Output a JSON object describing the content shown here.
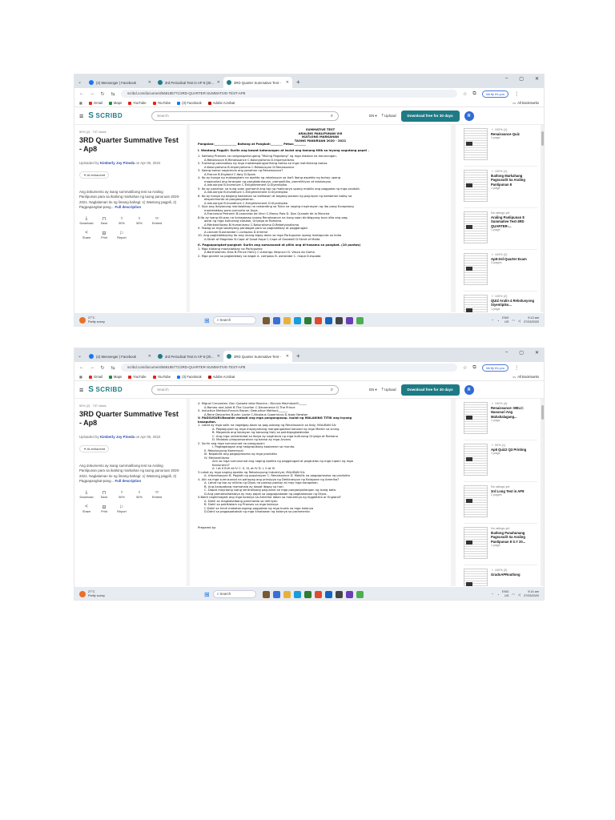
{
  "browser": {
    "tabs": [
      {
        "label": "(4) Messenger | Facebook",
        "icon": "facebook"
      },
      {
        "label": "3rd Periodical Test in AP 8 (2019-",
        "icon": "scribd"
      },
      {
        "label": "3RD Quarter Summative Test -",
        "icon": "scribd"
      }
    ],
    "new_tab": "+",
    "window_controls": [
      "–",
      "▢",
      "✕"
    ],
    "url": "scribd.com/document/568185771/3RD-QUARTER-SUMMATIVE-TEST-AP8",
    "verify_label": "Verify it's you",
    "bookmarks": [
      {
        "label": "Gmail",
        "color": "#d93025"
      },
      {
        "label": "Maps",
        "color": "#1e8e3e"
      },
      {
        "label": "YouTube",
        "color": "#e62117"
      },
      {
        "label": "YouTube",
        "color": "#e62117"
      },
      {
        "label": "(3) Facebook",
        "color": "#1877f2"
      },
      {
        "label": "Adobe Acrobat",
        "color": "#b30b00"
      }
    ],
    "all_bookmarks": "All Bookmarks"
  },
  "scribd": {
    "logo": "SCRIBD",
    "search_placeholder": "Search",
    "lang": "EN ▾",
    "upload": "Upload",
    "download_btn": "Download free for 30 days",
    "avatar": "R",
    "accent": "#1e7b85"
  },
  "doc_info": {
    "meta": "50% (2) · 737 views",
    "title": "3RD Quarter Summative Test - Ap8",
    "uploaded_prefix": "Uploaded by",
    "uploader": "Kimberly Joy Pineda",
    "uploaded_date": "on Apr 05, 2022",
    "ai_badge": "AI-enhanced",
    "description": "Ang dokumento ay isang summatibong test sa Araling Panlipunan para sa ikatlong markahan ng taong panuruan 2020-2021. Naglalaman ito ng limang bahagi: 1) Wastong pagpili, 2) Pagpapangkat-pang...",
    "full_desc": "Full description",
    "actions": [
      {
        "label": "Download",
        "icon": "⤓"
      },
      {
        "label": "Save",
        "icon": "⊓"
      },
      {
        "label": "50%",
        "icon": "♁"
      },
      {
        "label": "50%",
        "icon": "♁"
      },
      {
        "label": "Embed",
        "icon": "‹›"
      }
    ],
    "actions2": [
      {
        "label": "Share",
        "icon": "<"
      },
      {
        "label": "Print",
        "icon": "⊟"
      },
      {
        "label": "Report",
        "icon": "⚐"
      }
    ]
  },
  "page1": {
    "lines": [
      {
        "t": "SUMMATIVE TEST",
        "s": "c"
      },
      {
        "t": "ARALING PANLIPUNAN VIII",
        "s": "c"
      },
      {
        "t": "IKATLONG MARKAHAN",
        "s": "c"
      },
      {
        "t": "TAONG PANURUAN 2020 - 2021",
        "s": "c"
      },
      {
        "t": "Pangalan:_______________    Baitang at Pangkat:________    Petsa:________",
        "s": "b"
      },
      {
        "t": "",
        "s": "gap"
      },
      {
        "t": "I. Wastong Pagpili: Suriin ang bawat katanungan at isulat ang tamang titik sa inyong sagutang papel .",
        "s": "b"
      },
      {
        "t": "",
        "s": "gap"
      },
      {
        "t": "1. Salitang Pranses na nangangahulugang \"Muling Pagsilang\" ng mga klasikal na karunungan.",
        "s": ""
      },
      {
        "t": "A.Rebolusyon  B.Renaissance  C.Kolonyalismo  D.Imperyalismo",
        "s": "in1"
      },
      {
        "t": "2. Tuwirang pananakop ng mga makakapangyarihang bansa sa mga mahihinang bansa",
        "s": ""
      },
      {
        "t": "A.Kolonyalismo  B.Imperyalismo  C.Rebolusyon  D.Renaissance",
        "s": "in1"
      },
      {
        "t": "3. Saang bansa nagsimula ang panahon ng Renaissance?",
        "s": ""
      },
      {
        "t": "A.France  B.England  C.Italy  D.Spain",
        "s": "in1"
      },
      {
        "t": "4. Ito ay bunga ng makaagham na epekto ng rebelusyon sa iba't ibang aspekto ng buhay upang",
        "s": ""
      },
      {
        "t": "mapaunlad ang larangan ng pangkabuhayan, pampolitika, panrelihiyon at edukasyon.",
        "s": "in1"
      },
      {
        "t": "A.Industriyal  B.Inventure  C.Enlightenment  D.Siyentipiko",
        "s": "in1"
      },
      {
        "t": "5. Ito ay panahon na kung saan gumamit ang tao ng makinarya upang mabilis ang paggawa ng mga produkt.",
        "s": ""
      },
      {
        "t": "A.Industriyal  B.Invediture  C.Enlightenment  D.Siyentipiko",
        "s": "in1"
      },
      {
        "t": "6. Ito ay bunga ng bagong kaalaman sa kalikasan at bagong paraan ng pag-iipon ng kaalaman batay sa",
        "s": ""
      },
      {
        "t": "eksperimento at pangangatwiran.",
        "s": "in1"
      },
      {
        "t": "A.Industriyal  B.Invediture  C.Enlightenment  D.Siyentipiko",
        "s": "in1"
      },
      {
        "t": "7. Siya ang Italyanong manlalakbay na nakarating sa Tsina na naging inspirasyon ng iba pang Europeong",
        "s": ""
      },
      {
        "t": "manlalakbay para pumunta sa Asya.",
        "s": "in1"
      },
      {
        "t": "A.Francesco Petrarch  B.Leonardo da Vinci  C.Marco Polo  D. Don Quixote de la Mancha",
        "s": "in1"
      },
      {
        "t": "8.Ito ay isang kilusan na lumaganap noong Renaissance na kung saan binibigyang tuon dito ang pag-",
        "s": ""
      },
      {
        "t": "aaral ng mga kulturang klasikal, Griyego at Romano.",
        "s": "in1"
      },
      {
        "t": "A.Merkantilismo B.Humanismo C.Naturalismo D.Rebelyonalismo",
        "s": "in1"
      },
      {
        "t": "9. Tawag sa mga sasakyang pandagat para sa paglalakbay at paggalugad",
        "s": ""
      },
      {
        "t": "A.caravel  B.astrolabe  C.compass  D.trireme",
        "s": "in1"
      },
      {
        "t": "10. Ang paglalakbaying ito ang unang bigay daan sa mga Portuguese upang makapunta sa India",
        "s": ""
      },
      {
        "t": "A.Strait of Magellan  B.Cape of Good Hope  C.Cape of Goodwill  D.Strait of Malta",
        "s": "in1"
      },
      {
        "t": "",
        "s": "gap"
      },
      {
        "t": "II. Pagpapangkat-pangkat: Suriin ang sumusunod at piliin ang di-kasama sa pangkat. (10 puntos)",
        "s": "b"
      },
      {
        "t": "1. Mga kilalang manlalakbay na Portuguese",
        "s": ""
      },
      {
        "t": "A.Bartholomeu Dias  B.Prince Henry  C.Amerigo Vespucci D. Vasco da Gama",
        "s": "in1"
      },
      {
        "t": "2. Mga gnamit sa paglalakbay sa dagat A. compass B. astrolabe C. mapa  D.espada",
        "s": ""
      }
    ]
  },
  "page2": {
    "lines": [
      {
        "t": "4. Miguel Cervantes: Don Quixote dela Mancha ; Niccolo Machiavelli:_____",
        "s": ""
      },
      {
        "t": "A.Romeo and Juliet  B.The Courtier C.Decameron  D.The Prince",
        "s": "in1"
      },
      {
        "t": "5. Inductive Method:Francis Bacon; Deductive Method:______",
        "s": ""
      },
      {
        "t": "A.Rene Descartes  B.John Locke  C.Nicolaus Copernicus   D.Isaac Newton",
        "s": "in1"
      },
      {
        "t": "V. PAGSUSURI:Basahin mabuti ang mga pangungusap. Isulat ng MALAKING TITIK ang inyong",
        "s": "b"
      },
      {
        "t": "kasagutan.",
        "s": "b"
      },
      {
        "t": "1. Lahat ay mga salik na nagbigay-daan sa pag-usbong ng Renaissance sa Italy, MALIBAN SA:",
        "s": ""
      },
      {
        "t": "A.  Pagtaguyod ng mga mayayamang mangangalakal katulad ng mga Medici sa sining",
        "s": "in2"
      },
      {
        "t": "B.  Maganda ang lokasyon ng bansang Italy sa pakikipagkalakalan",
        "s": "in2"
      },
      {
        "t": "C.  Ang mga unibersidad sa Italya ay nagtuturo ng mga kulturang Griyego at Romano",
        "s": "in2"
      },
      {
        "t": "D.  Malakas pinoponsorohan ng bansa ay mga Arvans",
        "s": "in2"
      },
      {
        "t": "2. Suriin ang mga sumusunod na pangyayari:",
        "s": ""
      },
      {
        "t": "I. Pagtagatagan ang heograpikong kaalaman sa mundo.",
        "s": "in2"
      },
      {
        "t": "II. Rebolusyong Komersyal",
        "s": "in1"
      },
      {
        "t": "III. Napabilis ang pagpoproseso ng mga produkto",
        "s": "in1"
      },
      {
        "t": "IV. Merkantilismo",
        "s": "in1"
      },
      {
        "t": "Alin sa mga sumusunod ang naging epekto ng paggalugad at pagtuklas ng mga lupain ng mga",
        "s": "in2"
      },
      {
        "t": "Kanluranin?",
        "s": "in2"
      },
      {
        "t": "A. I at II  B.III at IV  C. II, III, at IV  D. I, II at IV",
        "s": "in2"
      },
      {
        "t": "3.Lahat ay mga naging epekto ng Rebolusyong Industriyal, MALIBAN SA:",
        "s": ""
      },
      {
        "t": "A. Urbanisasyon  B. Paglaki ng populasyon  C. Renaissance  D. Mabilis na pagpoproseso ng produkto",
        "s": "in1"
      },
      {
        "t": "4. Alin sa mga sumusunod na pahayag ang prinsipyo ng Deklarasyon ng Kalayaan ng Amerika?",
        "s": ""
      },
      {
        "t": "A. Lahat ng tao ay nilikha ng Diyos na pantay-pantay at may mga karapatan.",
        "s": "in1"
      },
      {
        "t": "B. Ang karapatang mamahala ay dapat ibigay sa hari.",
        "s": "in1"
      },
      {
        "t": "C. Dapat mayroong isang sentralisong pag-aaral sa mga pangangailangan ng isang bata.",
        "s": "in1"
      },
      {
        "t": "D.Ang pamamahalataya ay may papel sa pagpapalawak ng pagkakaroon ng Diyos.",
        "s": "in1"
      },
      {
        "t": "5.Bakit naghimagsik ang mga kolonya sa Amerika laban sa monarkiya ng Inggletera or England?",
        "s": ""
      },
      {
        "t": "A. Dahil sa magkakaibang paniniwala sa relihiyon",
        "s": "in1"
      },
      {
        "t": "B. Dahil sa pakikialam ng Pranses sa mga kolonya",
        "s": "in1"
      },
      {
        "t": "C.Dahil sa hindi makatarungang pagpataw ng mga buwis sa mga kolonya",
        "s": "in1"
      },
      {
        "t": "D.Dahil sa pagpapataksik ng mga kinatawan ng kolonya sa parlamento",
        "s": "in1"
      },
      {
        "t": "",
        "s": "gap"
      },
      {
        "t": "",
        "s": "gap"
      },
      {
        "t": "",
        "s": "gap"
      },
      {
        "t": "",
        "s": "gap"
      },
      {
        "t": "",
        "s": "gap"
      },
      {
        "t": "Prepared by:",
        "s": ""
      }
    ]
  },
  "sidebar1": [
    {
      "meta": "☺ 100% (1)",
      "title": "Renaissance Quiz",
      "foot": "1 page"
    },
    {
      "meta": "☺ 100% (1)",
      "title": "Ikatlong Markahang Pagsusulit Sa Araling Panlipunan 8",
      "foot": "1 page"
    },
    {
      "meta": "No ratings yet",
      "title": "Araling Panlipunan 8 Summative Test-3RD QUARTER-...",
      "foot": "1 page"
    },
    {
      "meta": "☺ 100% (2)",
      "title": "Ap8-3rd-Quarter Exam",
      "foot": "3 pages"
    },
    {
      "meta": "☺ 100% (2)",
      "title": "QUIZ Aralin 4 Rebolusyong Siyentipiko...",
      "foot": "1 page"
    }
  ],
  "sidebar2": [
    {
      "meta": "☺ 100% (4)",
      "title": "Renaissance: MELC: Nasusuri Ang Mahahalagang...",
      "foot": "1 page"
    },
    {
      "meta": "☺ 50% (1)",
      "title": "Ap8 Quiz2 Q3 Printing",
      "foot": "1 page"
    },
    {
      "meta": "No ratings yet",
      "title": "3rd Long Test in AP8",
      "foot": "2 pages"
    },
    {
      "meta": "No ratings yet",
      "title": "Ikatlong Panahunang Pagsusulit Sa Araling Panlipunan 8 S.Y 20...",
      "foot": "1 page"
    },
    {
      "meta": "☺ 100% (2)",
      "title": "GradoAPRoutlong",
      "foot": ""
    }
  ],
  "taskbar": {
    "weather1": [
      "27°C",
      "Partly sunny"
    ],
    "weather2": [
      "27°C",
      "Partly sunny"
    ],
    "search": "Search",
    "lang": [
      "ENG",
      "US"
    ],
    "clock1": [
      "9:13 am",
      "27/03/2020"
    ],
    "clock2": [
      "9:14 am",
      "27/03/2020"
    ]
  }
}
